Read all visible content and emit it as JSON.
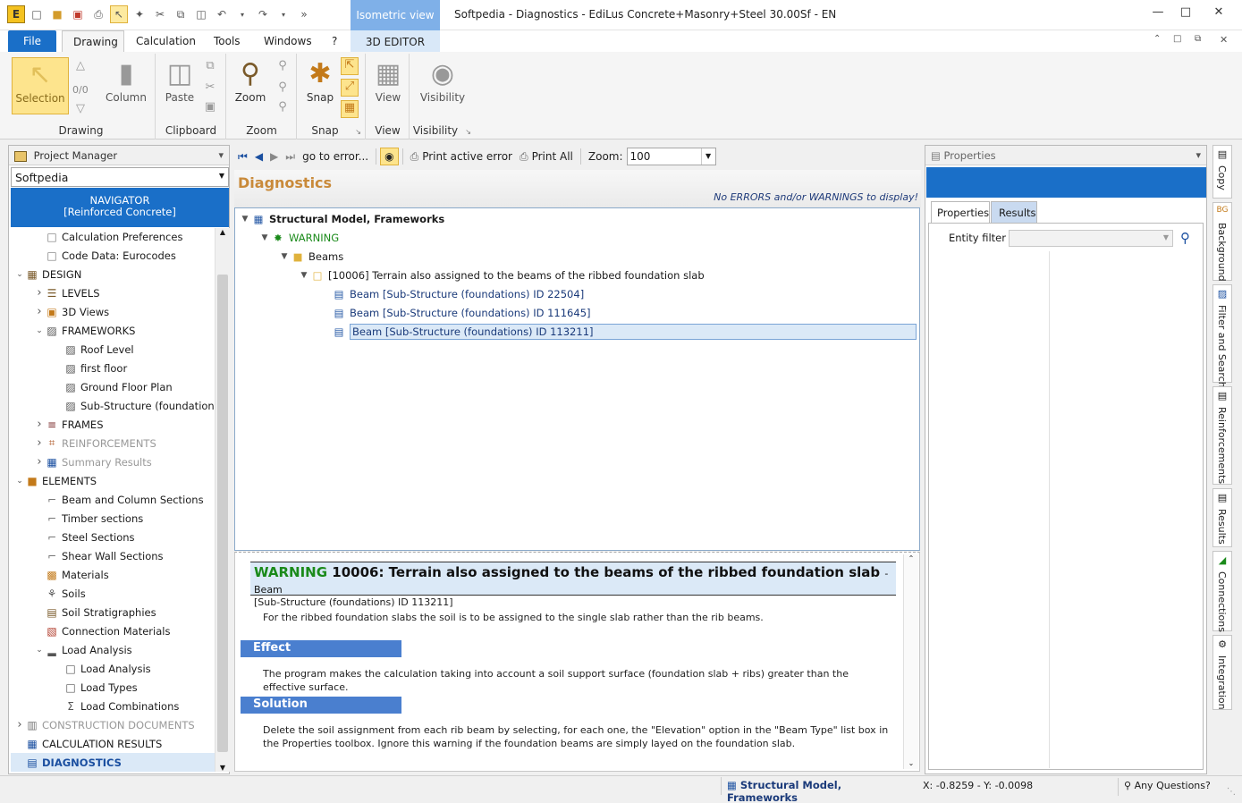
{
  "window": {
    "title": "Softpedia - Diagnostics - EdiLus Concrete+Masonry+Steel 30.00Sf - EN",
    "context_group": "Isometric view"
  },
  "ribbon_tabs": {
    "file": "File",
    "drawing": "Drawing",
    "calculation": "Calculation",
    "tools": "Tools",
    "windows": "Windows",
    "help": "?",
    "editor3d": "3D EDITOR"
  },
  "ribbon": {
    "selection": "Selection",
    "counter": "0/0",
    "column": "Column",
    "drawing_group": "Drawing",
    "paste": "Paste",
    "clipboard_group": "Clipboard",
    "zoom": "Zoom",
    "zoom_group": "Zoom",
    "snap": "Snap",
    "snap_group": "Snap",
    "view": "View",
    "view_group": "View",
    "visibility": "Visibility",
    "visibility_group": "Visibility"
  },
  "project_manager": {
    "title": "Project Manager",
    "project": "Softpedia",
    "navigator_line1": "NAVIGATOR",
    "navigator_line2": "[Reinforced Concrete]",
    "items": [
      {
        "label": "Calculation Preferences"
      },
      {
        "label": "Code Data: Eurocodes"
      },
      {
        "label": "DESIGN"
      },
      {
        "label": "LEVELS"
      },
      {
        "label": "3D Views"
      },
      {
        "label": "FRAMEWORKS"
      },
      {
        "label": "Roof Level"
      },
      {
        "label": "first floor"
      },
      {
        "label": "Ground Floor Plan"
      },
      {
        "label": "Sub-Structure (foundations)"
      },
      {
        "label": "FRAMES"
      },
      {
        "label": "REINFORCEMENTS"
      },
      {
        "label": "Summary Results"
      },
      {
        "label": "ELEMENTS"
      },
      {
        "label": "Beam and Column Sections"
      },
      {
        "label": "Timber sections"
      },
      {
        "label": "Steel Sections"
      },
      {
        "label": "Shear Wall Sections"
      },
      {
        "label": "Materials"
      },
      {
        "label": "Soils"
      },
      {
        "label": "Soil Stratigraphies"
      },
      {
        "label": "Connection Materials"
      },
      {
        "label": "Load Analysis"
      },
      {
        "label": "Load Analysis"
      },
      {
        "label": "Load Types"
      },
      {
        "label": "Load Combinations"
      },
      {
        "label": "CONSTRUCTION DOCUMENTS"
      },
      {
        "label": "CALCULATION RESULTS"
      },
      {
        "label": "DIAGNOSTICS"
      }
    ]
  },
  "diag_toolbar": {
    "goto": "go to error...",
    "print_active": "Print active error",
    "print_all": "Print All",
    "zoom_label": "Zoom:",
    "zoom_value": "100"
  },
  "diagnostics": {
    "title": "Diagnostics",
    "status": "No ERRORS and/or WARNINGS to display!",
    "tree": [
      {
        "label": "Structural Model, Frameworks"
      },
      {
        "label": "WARNING"
      },
      {
        "label": "Beams"
      },
      {
        "label": "[10006] Terrain also assigned to the beams of the ribbed foundation slab"
      },
      {
        "label": "Beam [Sub-Structure (foundations) ID 22504]"
      },
      {
        "label": "Beam [Sub-Structure (foundations) ID 111645]"
      },
      {
        "label": "Beam [Sub-Structure (foundations) ID 113211]"
      }
    ],
    "detail": {
      "warning_word": "WARNING",
      "code_title": "10006: Terrain also assigned to the beams of the ribbed foundation slab",
      "subject": "- Beam",
      "subject_id": "[Sub-Structure (foundations) ID 113211]",
      "description": "For the ribbed foundation slabs the soil is to be assigned to the single slab rather than the rib beams.",
      "effect_title": "Effect",
      "effect_text": "The program makes the calculation taking into account a soil support surface (foundation slab + ribs) greater than the effective surface.",
      "solution_title": "Solution",
      "solution_text": "Delete the soil assignment from each rib beam by selecting, for each one, the \"Elevation\" option in the \"Beam Type\" list box in the Properties toolbox. Ignore this warning if the foundation beams are simply layed on the foundation slab."
    }
  },
  "properties": {
    "title": "Properties",
    "tab_properties": "Properties",
    "tab_results": "Results",
    "entity_filter": "Entity filter"
  },
  "side_tabs": [
    "Copy",
    "Background",
    "Filter and Search",
    "Reinforcements",
    "Results",
    "Connections",
    "Integration"
  ],
  "statusbar": {
    "model": "Structural Model, Frameworks",
    "coords": "X: -0.8259 - Y: -0.0098",
    "help": "Any Questions?"
  },
  "colors": {
    "accent": "#1a6fc8",
    "warning_green": "#1a8a1a",
    "section_blue": "#4a7fcf",
    "title_orange": "#c98a3a"
  }
}
